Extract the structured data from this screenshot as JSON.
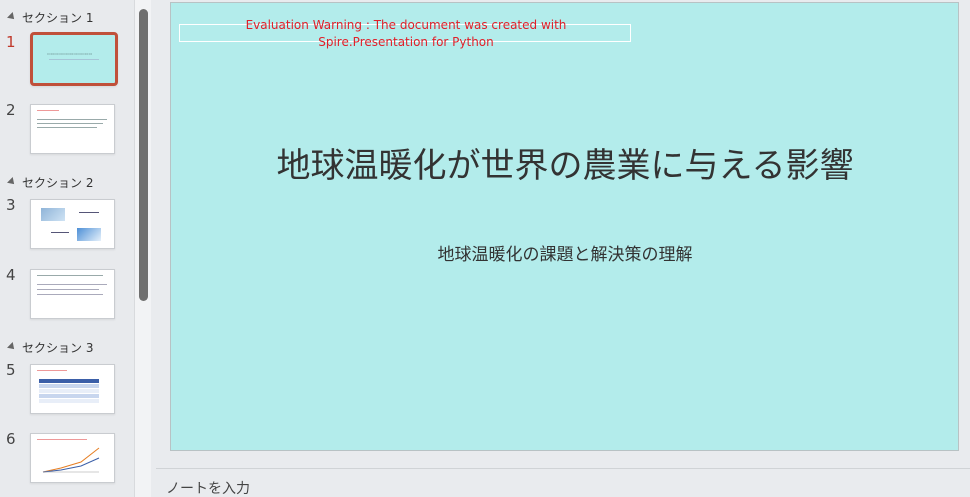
{
  "sections": [
    {
      "label": "セクション 1"
    },
    {
      "label": "セクション 2"
    },
    {
      "label": "セクション 3"
    }
  ],
  "slides": [
    {
      "number": "1"
    },
    {
      "number": "2"
    },
    {
      "number": "3"
    },
    {
      "number": "4"
    },
    {
      "number": "5"
    },
    {
      "number": "6"
    }
  ],
  "slide": {
    "warning": "Evaluation Warning : The document was created with Spire.Presentation for Python",
    "title": "地球温暖化が世界の農業に与える影響",
    "subtitle": "地球温暖化の課題と解決策の理解",
    "background_color": "#b3eceb"
  },
  "notes": {
    "placeholder": "ノートを入力"
  }
}
